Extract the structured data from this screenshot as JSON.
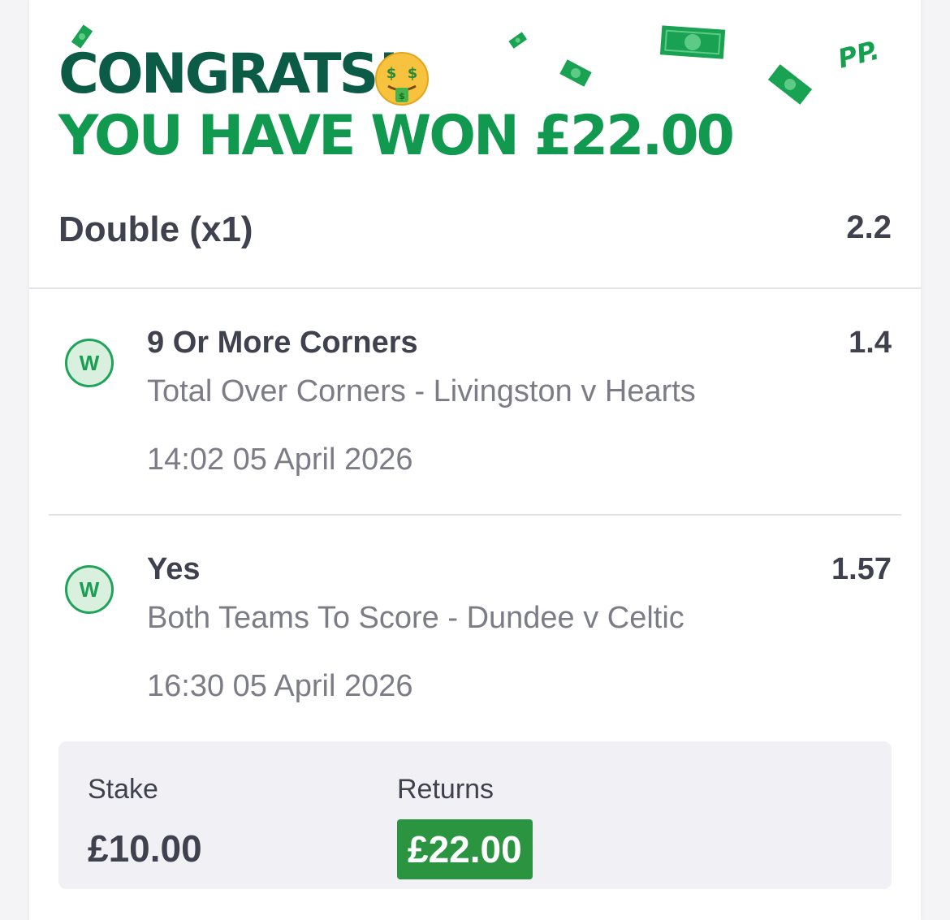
{
  "header": {
    "congrats": "CONGRATS!",
    "won_text": "YOU HAVE WON £22.00",
    "pp_logo": "PP.",
    "emoji_icon": "money-mouth-face-icon"
  },
  "bet": {
    "type": "Double (x1)",
    "odds": "2.2"
  },
  "selections": [
    {
      "result_badge": "W",
      "name": "9 Or More Corners",
      "odds": "1.4",
      "market": "Total Over Corners - Livingston v Hearts",
      "time": "14:02 05 April 2026"
    },
    {
      "result_badge": "W",
      "name": "Yes",
      "odds": "1.57",
      "market": "Both Teams To Score - Dundee v Celtic",
      "time": "16:30 05 April 2026"
    }
  ],
  "summary": {
    "stake_label": "Stake",
    "stake_value": "£10.00",
    "returns_label": "Returns",
    "returns_value": "£22.00"
  },
  "colors": {
    "dark_green": "#0b5b46",
    "brand_green": "#119a4f",
    "returns_bg": "#2a9440",
    "badge_bg": "#d8f0dd",
    "text_dark": "#40414e",
    "text_muted": "#7b7c86"
  }
}
